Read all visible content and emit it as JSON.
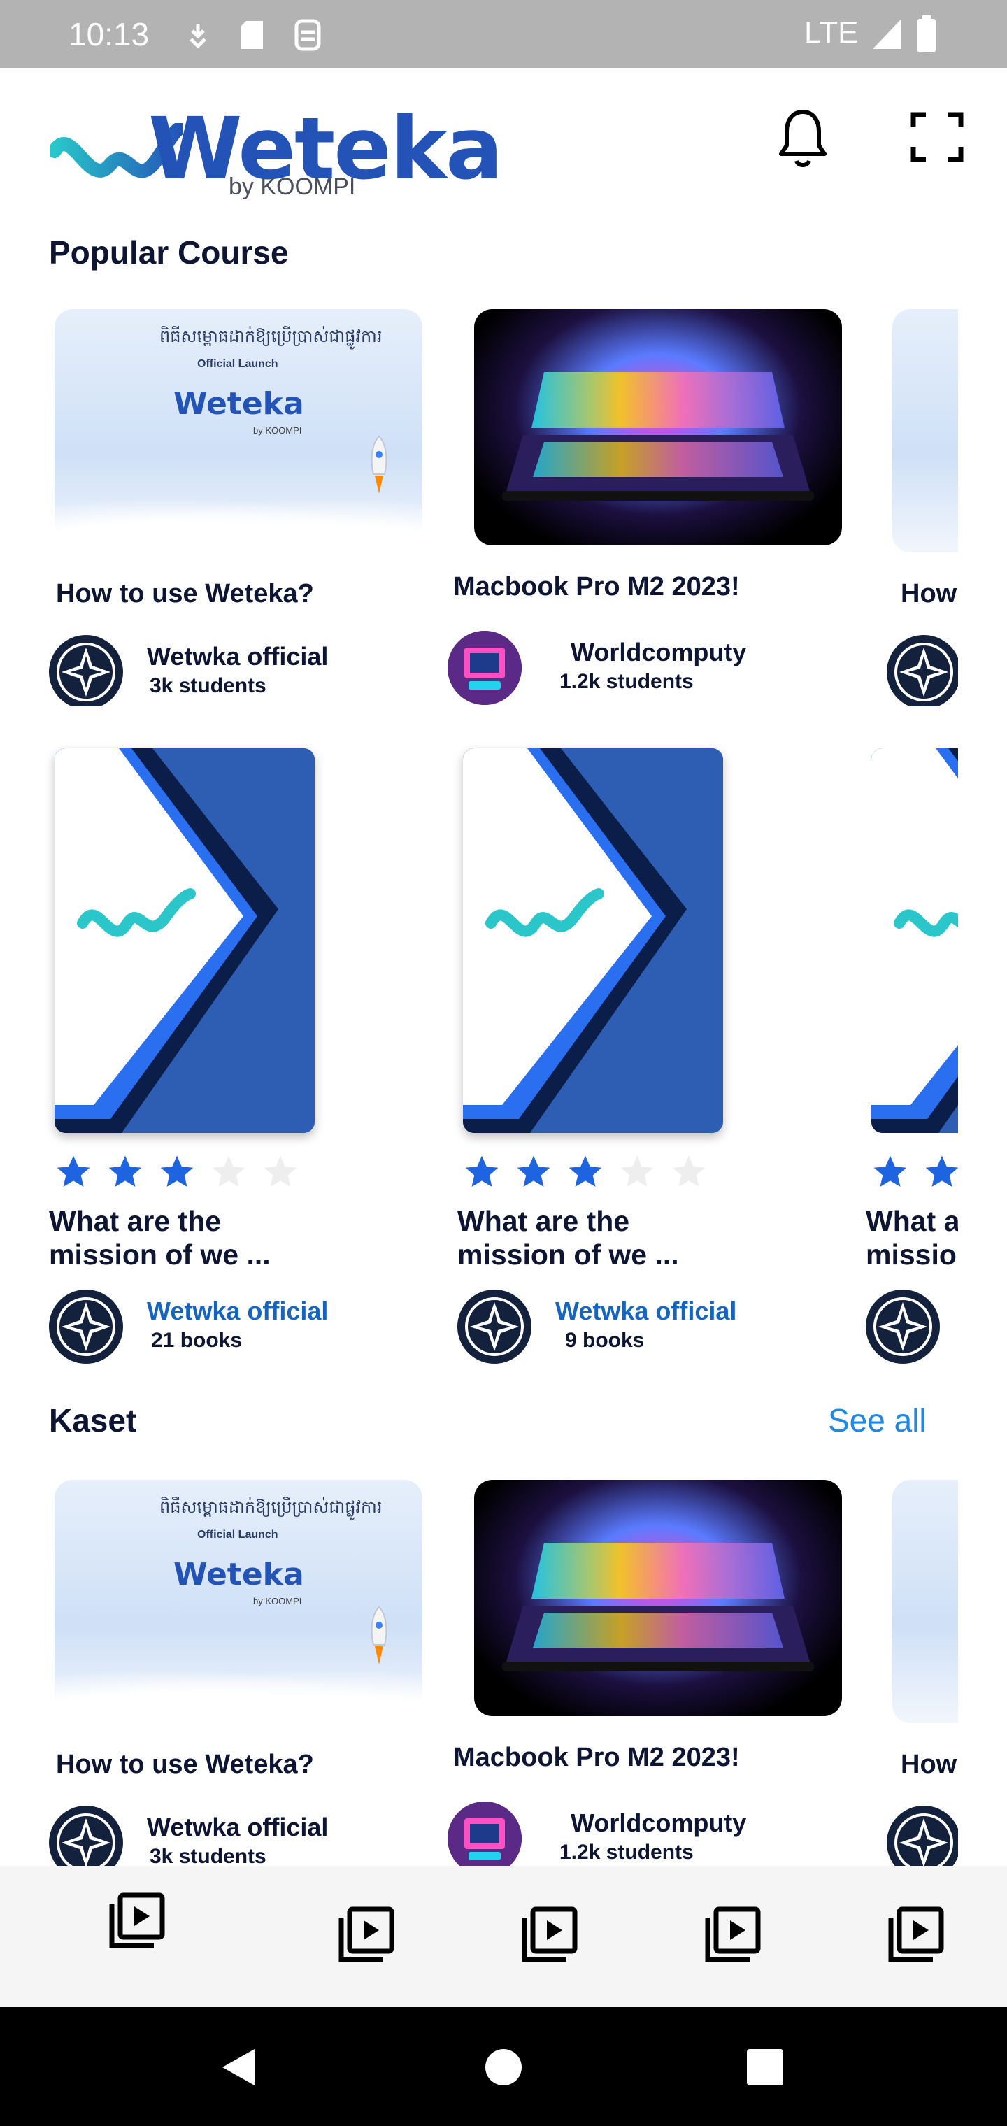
{
  "status_bar": {
    "time": "10:13",
    "network": "LTE"
  },
  "header": {
    "logo_text": "Weteka",
    "logo_sub": "by KOOMPI",
    "bell_icon": "bell-icon",
    "scan_icon": "fullscreen-icon"
  },
  "popular": {
    "title": "Popular Course",
    "courses": [
      {
        "title": "How to use Weteka?",
        "author": "Wetwka official",
        "count": "3k students",
        "thumb": "weteka-launch",
        "avatar": "star-logo"
      },
      {
        "title": "Macbook Pro M2 2023!",
        "author": "Worldcomputy",
        "count": "1.2k students",
        "thumb": "laptop",
        "avatar": "retro-computer"
      },
      {
        "title": "How",
        "thumb": "weteka-launch",
        "avatar": "star-logo"
      }
    ]
  },
  "books": {
    "items": [
      {
        "title_line1": "What are the",
        "title_line2": "mission of we ...",
        "author": "Wetwka official",
        "count": "21 books",
        "rating": 3,
        "max_rating": 5
      },
      {
        "title_line1": "What are the",
        "title_line2": "mission of we ...",
        "author": "Wetwka official",
        "count": "9 books",
        "rating": 3,
        "max_rating": 5
      },
      {
        "title_line1": "What a",
        "title_line2": "missio",
        "rating": 3,
        "max_rating": 5
      }
    ]
  },
  "kaset": {
    "title": "Kaset",
    "see_all": "See all",
    "courses": [
      {
        "title": "How to use Weteka?",
        "author": "Wetwka official",
        "count": "3k students",
        "thumb": "weteka-launch",
        "avatar": "star-logo"
      },
      {
        "title": "Macbook Pro M2 2023!",
        "author": "Worldcomputy",
        "count": "1.2k students",
        "thumb": "laptop",
        "avatar": "retro-computer"
      },
      {
        "title": "How",
        "thumb": "weteka-launch",
        "avatar": "star-logo"
      }
    ]
  },
  "thumb_text": {
    "khmer_line": "ពិធីសម្ពោធដាក់ឱ្យប្រើប្រាស់ជាផ្លូវការ",
    "official_launch": "Official Launch",
    "brand": "Weteka",
    "brand_sub": "by KOOMPI"
  },
  "bottom_nav": [
    {
      "icon": "video-library-icon"
    },
    {
      "icon": "video-library-icon"
    },
    {
      "icon": "video-library-icon"
    },
    {
      "icon": "video-library-icon"
    },
    {
      "icon": "video-library-icon"
    }
  ],
  "colors": {
    "accent_blue": "#1e88e5",
    "dark_navy": "#0d1533",
    "star_blue": "#1e63e0",
    "star_gray": "#eeeeee"
  }
}
